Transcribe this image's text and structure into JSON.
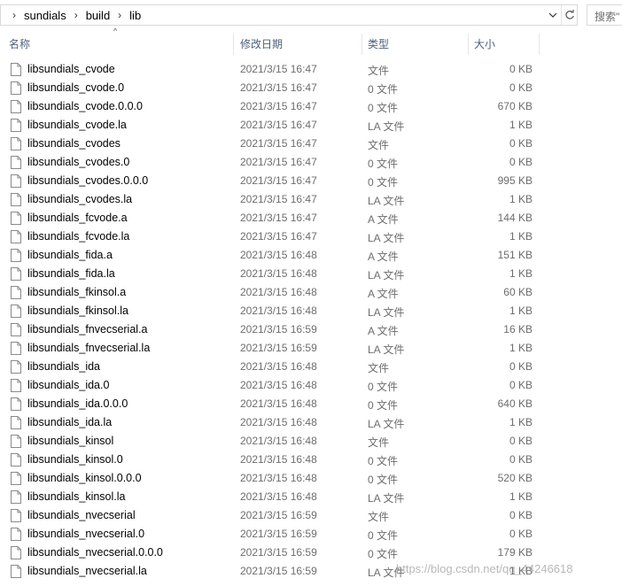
{
  "address": {
    "crumbs": [
      "sundials",
      "build",
      "lib"
    ],
    "search_placeholder": "搜索\""
  },
  "columns": {
    "name": "名称",
    "date": "修改日期",
    "type": "类型",
    "size": "大小"
  },
  "files": [
    {
      "name": "libsundials_cvode",
      "date": "2021/3/15 16:47",
      "type": "文件",
      "size": "0 KB"
    },
    {
      "name": "libsundials_cvode.0",
      "date": "2021/3/15 16:47",
      "type": "0 文件",
      "size": "0 KB"
    },
    {
      "name": "libsundials_cvode.0.0.0",
      "date": "2021/3/15 16:47",
      "type": "0 文件",
      "size": "670 KB"
    },
    {
      "name": "libsundials_cvode.la",
      "date": "2021/3/15 16:47",
      "type": "LA 文件",
      "size": "1 KB"
    },
    {
      "name": "libsundials_cvodes",
      "date": "2021/3/15 16:47",
      "type": "文件",
      "size": "0 KB"
    },
    {
      "name": "libsundials_cvodes.0",
      "date": "2021/3/15 16:47",
      "type": "0 文件",
      "size": "0 KB"
    },
    {
      "name": "libsundials_cvodes.0.0.0",
      "date": "2021/3/15 16:47",
      "type": "0 文件",
      "size": "995 KB"
    },
    {
      "name": "libsundials_cvodes.la",
      "date": "2021/3/15 16:47",
      "type": "LA 文件",
      "size": "1 KB"
    },
    {
      "name": "libsundials_fcvode.a",
      "date": "2021/3/15 16:47",
      "type": "A 文件",
      "size": "144 KB"
    },
    {
      "name": "libsundials_fcvode.la",
      "date": "2021/3/15 16:47",
      "type": "LA 文件",
      "size": "1 KB"
    },
    {
      "name": "libsundials_fida.a",
      "date": "2021/3/15 16:48",
      "type": "A 文件",
      "size": "151 KB"
    },
    {
      "name": "libsundials_fida.la",
      "date": "2021/3/15 16:48",
      "type": "LA 文件",
      "size": "1 KB"
    },
    {
      "name": "libsundials_fkinsol.a",
      "date": "2021/3/15 16:48",
      "type": "A 文件",
      "size": "60 KB"
    },
    {
      "name": "libsundials_fkinsol.la",
      "date": "2021/3/15 16:48",
      "type": "LA 文件",
      "size": "1 KB"
    },
    {
      "name": "libsundials_fnvecserial.a",
      "date": "2021/3/15 16:59",
      "type": "A 文件",
      "size": "16 KB"
    },
    {
      "name": "libsundials_fnvecserial.la",
      "date": "2021/3/15 16:59",
      "type": "LA 文件",
      "size": "1 KB"
    },
    {
      "name": "libsundials_ida",
      "date": "2021/3/15 16:48",
      "type": "文件",
      "size": "0 KB"
    },
    {
      "name": "libsundials_ida.0",
      "date": "2021/3/15 16:48",
      "type": "0 文件",
      "size": "0 KB"
    },
    {
      "name": "libsundials_ida.0.0.0",
      "date": "2021/3/15 16:48",
      "type": "0 文件",
      "size": "640 KB"
    },
    {
      "name": "libsundials_ida.la",
      "date": "2021/3/15 16:48",
      "type": "LA 文件",
      "size": "1 KB"
    },
    {
      "name": "libsundials_kinsol",
      "date": "2021/3/15 16:48",
      "type": "文件",
      "size": "0 KB"
    },
    {
      "name": "libsundials_kinsol.0",
      "date": "2021/3/15 16:48",
      "type": "0 文件",
      "size": "0 KB"
    },
    {
      "name": "libsundials_kinsol.0.0.0",
      "date": "2021/3/15 16:48",
      "type": "0 文件",
      "size": "520 KB"
    },
    {
      "name": "libsundials_kinsol.la",
      "date": "2021/3/15 16:48",
      "type": "LA 文件",
      "size": "1 KB"
    },
    {
      "name": "libsundials_nvecserial",
      "date": "2021/3/15 16:59",
      "type": "文件",
      "size": "0 KB"
    },
    {
      "name": "libsundials_nvecserial.0",
      "date": "2021/3/15 16:59",
      "type": "0 文件",
      "size": "0 KB"
    },
    {
      "name": "libsundials_nvecserial.0.0.0",
      "date": "2021/3/15 16:59",
      "type": "0 文件",
      "size": "179 KB"
    },
    {
      "name": "libsundials_nvecserial.la",
      "date": "2021/3/15 16:59",
      "type": "LA 文件",
      "size": "1 KB"
    }
  ],
  "watermark": "https://blog.csdn.net/qq_44246618",
  "colors": {
    "header_text": "#4c607a",
    "secondary_text": "#6d6d6d",
    "border": "#d9d9d9"
  }
}
